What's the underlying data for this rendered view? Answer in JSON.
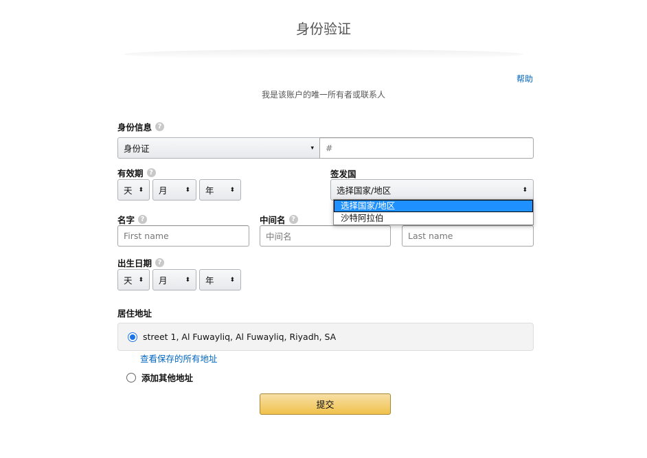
{
  "header": {
    "title": "身份验证",
    "help_link": "帮助",
    "subtitle": "我是该账户的唯一所有者或联系人"
  },
  "id_info": {
    "label": "身份信息",
    "id_type_selected": "身份证",
    "id_number_placeholder": "#"
  },
  "expiry": {
    "label": "有效期",
    "day": "天",
    "month": "月",
    "year": "年"
  },
  "issuing_country": {
    "label": "签发国",
    "selected": "选择国家/地区",
    "options": [
      "选择国家/地区",
      "沙特阿拉伯"
    ]
  },
  "name": {
    "first_label": "名字",
    "middle_label": "中间名",
    "first_placeholder": "First name",
    "middle_placeholder": "中间名",
    "last_placeholder": "Last name"
  },
  "dob": {
    "label": "出生日期",
    "day": "天",
    "month": "月",
    "year": "年"
  },
  "residence": {
    "label": "居住地址",
    "saved_address": "street 1, Al Fuwayliq, Al Fuwayliq, Riyadh, SA",
    "view_all_link": "查看保存的所有地址",
    "add_other": "添加其他地址"
  },
  "submit_label": "提交",
  "icons": {
    "question": "?",
    "select_arrow": "⬍"
  },
  "colors": {
    "link": "#0066c0",
    "submit_bg": "#f0c14b",
    "dropdown_highlight": "#1e90ff"
  }
}
